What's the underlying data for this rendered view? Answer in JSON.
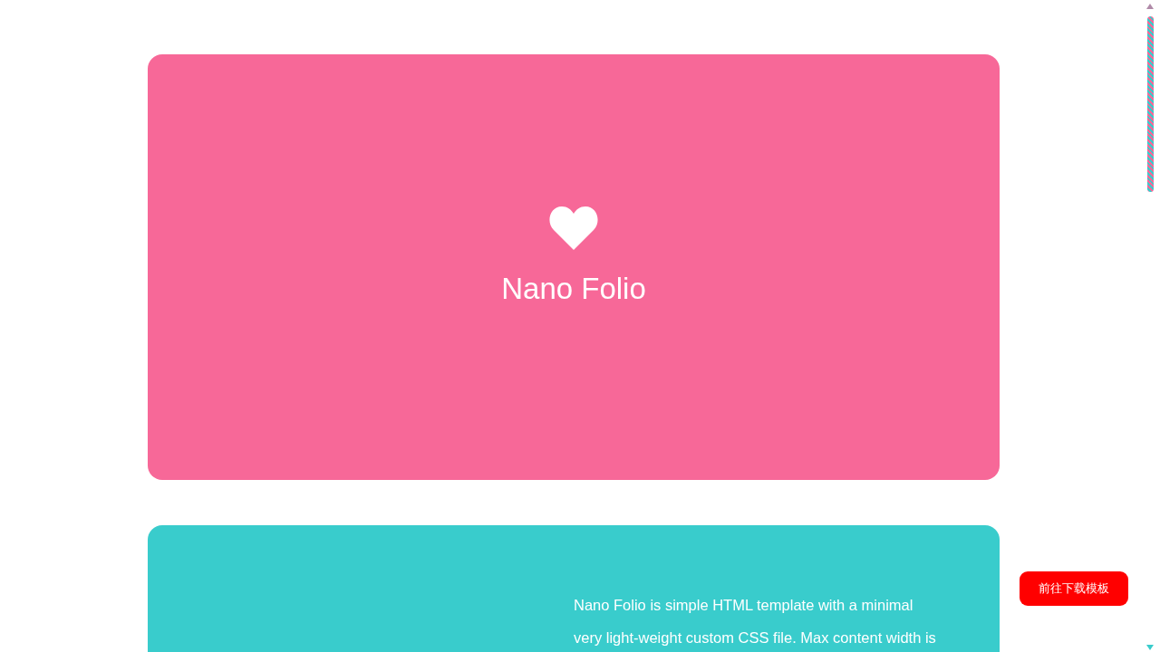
{
  "hero": {
    "title": "Nano Folio"
  },
  "about": {
    "lines": [
      "Nano Folio is simple HTML template with a minimal",
      "very light-weight custom CSS file. Max content width is"
    ]
  },
  "download_button": {
    "label": "前往下载模板"
  }
}
